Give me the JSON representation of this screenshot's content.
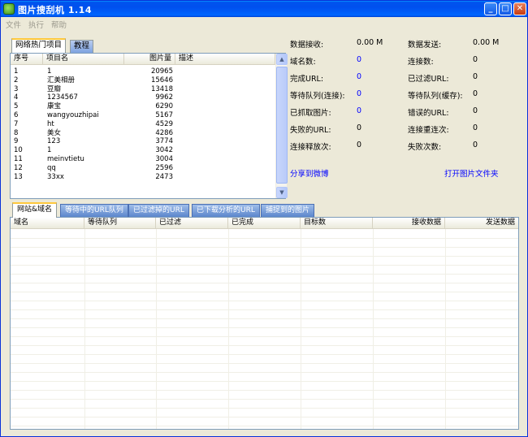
{
  "window": {
    "title": "图片搜刮机  1.14"
  },
  "menu": [
    {
      "label": "文件"
    },
    {
      "label": "执行"
    },
    {
      "label": "帮助"
    }
  ],
  "top_tabs": [
    {
      "label": "网络热门项目",
      "active": true
    },
    {
      "label": "教程",
      "active": false
    }
  ],
  "project_table": {
    "headers": [
      "序号",
      "项目名",
      "图片量",
      "描述"
    ],
    "rows": [
      {
        "idx": "1",
        "name": "1",
        "count": "20965",
        "desc": ""
      },
      {
        "idx": "2",
        "name": "汇美相册",
        "count": "15646",
        "desc": ""
      },
      {
        "idx": "3",
        "name": "豆瓣",
        "count": "13418",
        "desc": ""
      },
      {
        "idx": "4",
        "name": "1234567",
        "count": "9962",
        "desc": ""
      },
      {
        "idx": "5",
        "name": "康宝",
        "count": "6290",
        "desc": ""
      },
      {
        "idx": "6",
        "name": "wangyouzhipai",
        "count": "5167",
        "desc": ""
      },
      {
        "idx": "7",
        "name": "ht",
        "count": "4529",
        "desc": ""
      },
      {
        "idx": "8",
        "name": "美女",
        "count": "4286",
        "desc": ""
      },
      {
        "idx": "9",
        "name": "123",
        "count": "3774",
        "desc": ""
      },
      {
        "idx": "10",
        "name": "1",
        "count": "3042",
        "desc": ""
      },
      {
        "idx": "11",
        "name": "meinvtietu",
        "count": "3004",
        "desc": ""
      },
      {
        "idx": "12",
        "name": "qq",
        "count": "2596",
        "desc": ""
      },
      {
        "idx": "13",
        "name": "33xx",
        "count": "2473",
        "desc": ""
      }
    ]
  },
  "stats": {
    "left": [
      {
        "label": "数据接收:",
        "value": "0.00 M",
        "blue": false
      },
      {
        "label": "域名数:",
        "value": "0",
        "blue": true
      },
      {
        "label": "完成URL:",
        "value": "0",
        "blue": true
      },
      {
        "label": "等待队列(连接):",
        "value": "0",
        "blue": true
      },
      {
        "label": "已抓取图片:",
        "value": "0",
        "blue": true
      },
      {
        "label": "失败的URL:",
        "value": "0",
        "blue": false
      },
      {
        "label": "连接释放次:",
        "value": "0",
        "blue": false
      }
    ],
    "right": [
      {
        "label": "数据发送:",
        "value": "0.00 M",
        "blue": false
      },
      {
        "label": "连接数:",
        "value": "0",
        "blue": false
      },
      {
        "label": "已过滤URL:",
        "value": "0",
        "blue": false
      },
      {
        "label": "等待队列(缓存):",
        "value": "0",
        "blue": false
      },
      {
        "label": "错误的URL:",
        "value": "0",
        "blue": false
      },
      {
        "label": "连接重连次:",
        "value": "0",
        "blue": false
      },
      {
        "label": "失败次数:",
        "value": "0",
        "blue": false
      }
    ]
  },
  "links": {
    "share": "分享到微博",
    "open_folder": "打开图片文件夹"
  },
  "bottom_tabs": [
    {
      "label": "网站&域名",
      "active": true
    },
    {
      "label": "等待中的URL队列",
      "active": false
    },
    {
      "label": "已过滤掉的URL",
      "active": false
    },
    {
      "label": "已下载分析的URL",
      "active": false
    },
    {
      "label": "捕捉到的图片",
      "active": false
    }
  ],
  "domain_table": {
    "headers": [
      "域名",
      "等待队列",
      "已过滤",
      "已完成",
      "目标数",
      "接收数据",
      "发送数据"
    ]
  },
  "colors": {
    "title_bar": "#0054e3",
    "window_bg": "#ece9d8",
    "link": "#0000ff",
    "active_tab_accent": "#ffc83c",
    "inactive_bottom_tab": "#6b93d6"
  }
}
